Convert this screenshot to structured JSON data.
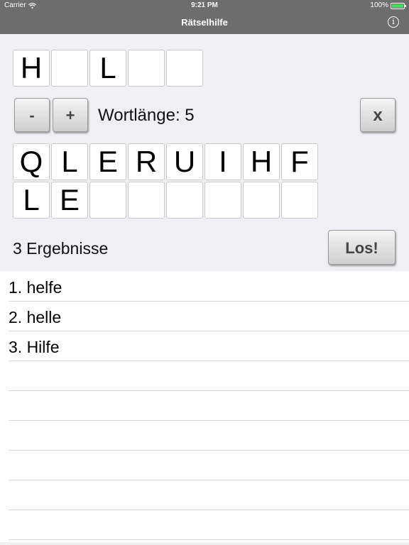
{
  "status": {
    "carrier": "Carrier",
    "time": "9:21 PM",
    "battery": "100%"
  },
  "nav": {
    "title": "Rätselhilfe",
    "info_glyph": "i"
  },
  "pattern": [
    "H",
    "",
    "L",
    "",
    ""
  ],
  "controls": {
    "minus": "-",
    "plus": "+",
    "length_label": "Wortlänge: 5",
    "clear": "x"
  },
  "letters_row1": [
    "Q",
    "L",
    "E",
    "R",
    "U",
    "I",
    "H",
    "F"
  ],
  "letters_row2": [
    "L",
    "E",
    "",
    "",
    "",
    "",
    "",
    ""
  ],
  "results": {
    "count_label": "3 Ergebnisse",
    "go": "Los!"
  },
  "result_items": [
    "1. helfe",
    "2. helle",
    "3. Hilfe",
    "",
    "",
    "",
    "",
    ""
  ],
  "colors": {
    "nav_bar": "#6d6d6d",
    "panel": "#efeff4",
    "battery": "#4cd964"
  }
}
